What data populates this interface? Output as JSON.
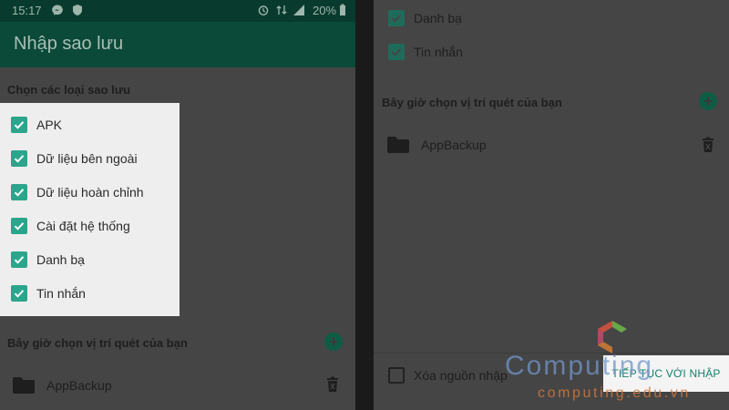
{
  "status_bar": {
    "time": "15:17",
    "battery": "20%"
  },
  "app_bar": {
    "title": "Nhập sao lưu"
  },
  "backup_types": {
    "heading": "Chọn các loại sao lưu",
    "items": [
      {
        "label": "APK",
        "checked": true
      },
      {
        "label": "Dữ liệu bên ngoài",
        "checked": true
      },
      {
        "label": "Dữ liệu hoàn chỉnh",
        "checked": true
      },
      {
        "label": "Cài đặt hệ thống",
        "checked": true
      },
      {
        "label": "Danh bạ",
        "checked": true
      },
      {
        "label": "Tin nhắn",
        "checked": true
      }
    ]
  },
  "scan_location": {
    "heading": "Bây giờ chọn vị trí quét của bạn",
    "folder": "AppBackup"
  },
  "bottom": {
    "delete_source_label": "Xóa nguồn nhập",
    "delete_source_checked": false,
    "continue_label": "TIẾP TỤC VỚI NHẬP"
  },
  "watermark": {
    "brand": "Computing",
    "url": "computing.edu.vn"
  },
  "colors": {
    "accent": "#2ba58b",
    "app_bar": "#0b4a38",
    "status_bar": "#083b2d",
    "continue_text": "#15806b"
  },
  "icons": {
    "check": "check-icon",
    "add": "plus-icon",
    "folder": "folder-icon",
    "delete": "trash-icon"
  }
}
